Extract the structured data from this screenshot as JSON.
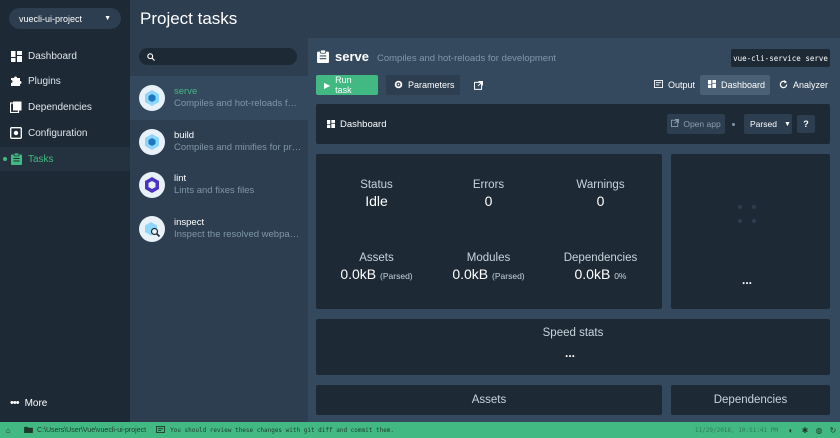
{
  "project": {
    "name": "vuecli-ui-project"
  },
  "nav": {
    "items": [
      {
        "label": "Dashboard",
        "icon": "dashboard-icon"
      },
      {
        "label": "Plugins",
        "icon": "puzzle-icon"
      },
      {
        "label": "Dependencies",
        "icon": "book-icon"
      },
      {
        "label": "Configuration",
        "icon": "settings-icon"
      },
      {
        "label": "Tasks",
        "icon": "clipboard-icon",
        "active": true
      }
    ],
    "more_label": "More"
  },
  "page": {
    "title": "Project tasks"
  },
  "tasks": {
    "search_placeholder": "",
    "items": [
      {
        "name": "serve",
        "desc": "Compiles and hot-reloads for development",
        "selected": true
      },
      {
        "name": "build",
        "desc": "Compiles and minifies for production"
      },
      {
        "name": "lint",
        "desc": "Lints and fixes files"
      },
      {
        "name": "inspect",
        "desc": "Inspect the resolved webpack config"
      }
    ]
  },
  "current_task": {
    "name": "serve",
    "desc": "Compiles and hot-reloads for development",
    "command": "vue-cli-service serve"
  },
  "toolbar": {
    "run_label": "Run task",
    "params_label": "Parameters",
    "output_label": "Output",
    "dashboard_label": "Dashboard",
    "analyzer_label": "Analyzer"
  },
  "dashboard": {
    "title": "Dashboard",
    "open_app_label": "Open app",
    "mode_value": "Parsed",
    "help_label": "?"
  },
  "stats": {
    "status": {
      "label": "Status",
      "value": "Idle"
    },
    "errors": {
      "label": "Errors",
      "value": "0"
    },
    "warnings": {
      "label": "Warnings",
      "value": "0"
    },
    "assets": {
      "label": "Assets",
      "value": "0.0kB",
      "note": "(Parsed)"
    },
    "modules": {
      "label": "Modules",
      "value": "0.0kB",
      "note": "(Parsed)"
    },
    "dependencies": {
      "label": "Dependencies",
      "value": "0.0kB",
      "note": "0%"
    }
  },
  "panels": {
    "speed_title": "Speed stats",
    "ellipsis": "...",
    "assets_title": "Assets",
    "deps_title": "Dependencies"
  },
  "statusbar": {
    "path": "C:\\Users\\User\\Vue\\vuecli-ui-project",
    "message": "You should review these changes with git diff and commit them.",
    "time": "11/29/2018, 10:51:41 PM"
  },
  "colors": {
    "accent": "#42b983",
    "sidebar": "#1d2935",
    "background": "#2c3e50",
    "panel": "#34495e"
  }
}
